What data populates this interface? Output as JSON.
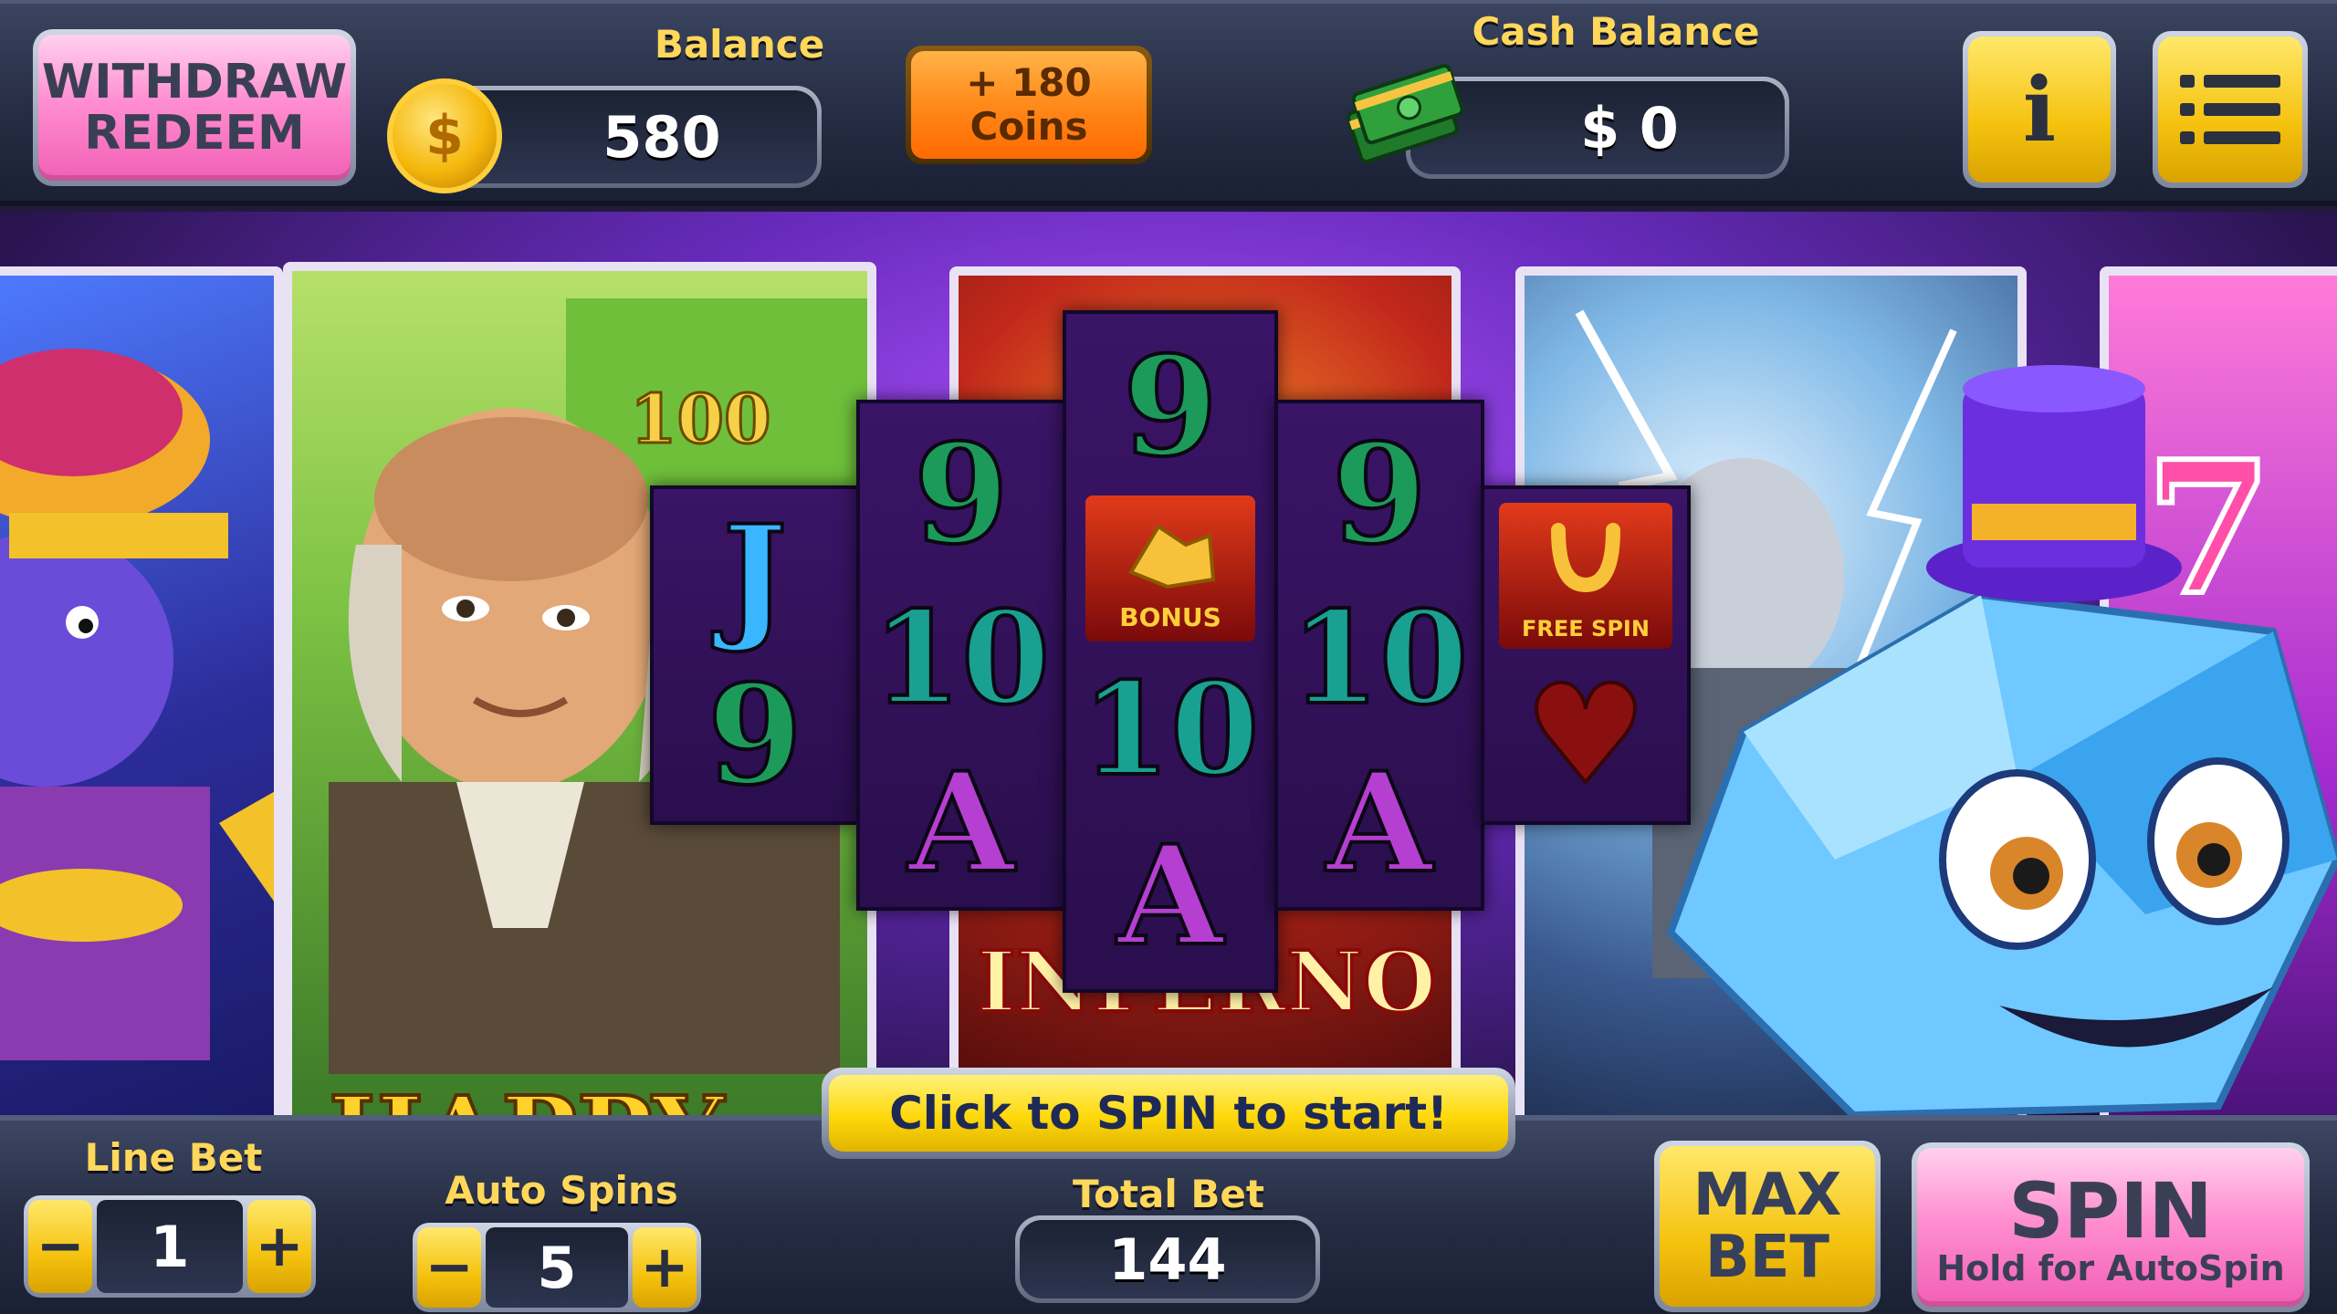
{
  "top": {
    "withdraw_line1": "WITHDRAW",
    "withdraw_line2": "REDEEM",
    "balance_label": "Balance",
    "balance_value": "580",
    "coins_line1": "+ 180",
    "coins_line2": "Coins",
    "cash_label": "Cash Balance",
    "cash_value": "$ 0",
    "info_label": "i"
  },
  "machines": {
    "happy_title": "HAPPY",
    "inferno_title": "INFERNO",
    "bill_number": "100"
  },
  "reels": {
    "reel1": [
      "J",
      "9"
    ],
    "reel2": [
      "9",
      "10",
      "A"
    ],
    "reel3": [
      "9",
      "BONUS",
      "10",
      "A"
    ],
    "reel4": [
      "9",
      "10",
      "A"
    ],
    "reel5": [
      "FREE SPIN",
      "♥"
    ]
  },
  "bottom": {
    "spin_prompt": "Click to SPIN to start!",
    "line_bet_label": "Line Bet",
    "line_bet_value": "1",
    "auto_spins_label": "Auto Spins",
    "auto_spins_value": "5",
    "total_bet_label": "Total Bet",
    "total_bet_value": "144",
    "max_line1": "MAX",
    "max_line2": "BET",
    "spin_label": "SPIN",
    "spin_sub": "Hold for AutoSpin",
    "minus": "−",
    "plus": "+"
  },
  "colors": {
    "gold_label": "#ffd75a",
    "pink_button": "#ff8fd0",
    "yellow_button": "#f5c20f",
    "orange_button": "#ff8a1a"
  }
}
